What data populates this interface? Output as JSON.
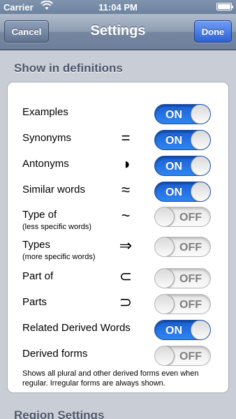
{
  "status_bar": {
    "carrier": "Carrier",
    "time": "11:04 PM",
    "battery_level": 1.0
  },
  "nav": {
    "title": "Settings",
    "cancel_label": "Cancel",
    "done_label": "Done"
  },
  "section_show_in_definitions": {
    "header": "Show in definitions",
    "rows": [
      {
        "label": "Examples",
        "sub": "",
        "symbol": "",
        "state": "ON",
        "on": true
      },
      {
        "label": "Synonyms",
        "sub": "",
        "symbol": "=",
        "state": "ON",
        "on": true
      },
      {
        "label": "Antonyms",
        "sub": "",
        "symbol": "◑",
        "state": "ON",
        "on": true
      },
      {
        "label": "Similar words",
        "sub": "",
        "symbol": "≈",
        "state": "ON",
        "on": true
      },
      {
        "label": "Type of",
        "sub": "(less specific words)",
        "symbol": "~",
        "state": "OFF",
        "on": false
      },
      {
        "label": "Types",
        "sub": "(more specific words)",
        "symbol": "⇒",
        "state": "OFF",
        "on": false
      },
      {
        "label": "Part of",
        "sub": "",
        "symbol": "⊂",
        "state": "OFF",
        "on": false
      },
      {
        "label": "Parts",
        "sub": "",
        "symbol": "⊃",
        "state": "OFF",
        "on": false
      },
      {
        "label": "Related Derived Words",
        "sub": "",
        "symbol": "",
        "state": "ON",
        "on": true
      },
      {
        "label": "Derived forms",
        "sub": "",
        "symbol": "",
        "state": "OFF",
        "on": false
      }
    ],
    "footer_note": "Shows all plural and other derived forms even when regular. Irregular forms are always shown."
  },
  "section_region_settings": {
    "header": "Region Settings"
  },
  "colors": {
    "switch_on": "#2f86f0",
    "nav_done": "#2d62d6"
  }
}
